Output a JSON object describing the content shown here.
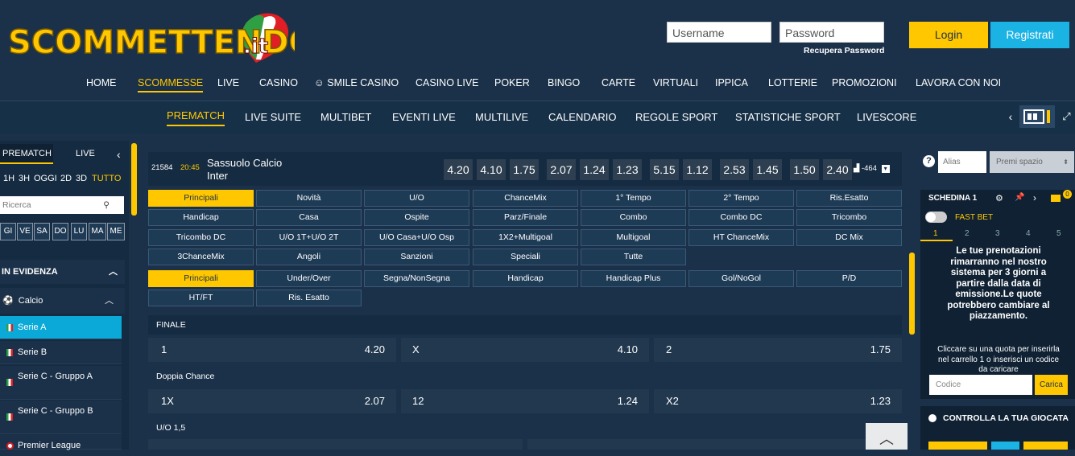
{
  "header": {
    "logo_text": "SCOMMETTENDO",
    "logo_suffix": ".it",
    "username_placeholder": "Username",
    "password_placeholder": "Password",
    "recover_password": "Recupera Password",
    "login": "Login",
    "register": "Registrati",
    "colors": {
      "accent": "#ffc700",
      "register": "#1bb2e4",
      "bg": "#1b3149"
    }
  },
  "main_nav": [
    "HOME",
    "SCOMMESSE",
    "LIVE",
    "CASINO",
    "SMILE CASINO",
    "CASINO LIVE",
    "POKER",
    "BINGO",
    "CARTE",
    "VIRTUALI",
    "IPPICA",
    "LOTTERIE",
    "PROMOZIONI",
    "LAVORA CON NOI"
  ],
  "sub_nav": [
    "PREMATCH",
    "LIVE SUITE",
    "MULTIBET",
    "EVENTI LIVE",
    "MULTILIVE",
    "CALENDARIO",
    "REGOLE SPORT",
    "STATISTICHE SPORT",
    "LIVESCORE"
  ],
  "left": {
    "tab_prematch": "PREMATCH",
    "tab_live": "LIVE",
    "filters": [
      "1H",
      "3H",
      "OGGI",
      "2D",
      "3D",
      "TUTTO"
    ],
    "search_placeholder": "Ricerca",
    "days": [
      "GI",
      "VE",
      "SA",
      "DO",
      "LU",
      "MA",
      "ME"
    ],
    "in_evidenza": "IN EVIDENZA",
    "sport": "Calcio",
    "leagues": [
      "Serie A",
      "Serie B",
      "Serie C - Gruppo A",
      "Serie C - Gruppo B",
      "Premier League"
    ]
  },
  "event": {
    "code": "21584",
    "time": "20:45",
    "home": "Sassuolo Calcio",
    "away": "Inter",
    "odds": [
      "4.20",
      "4.10",
      "1.75",
      "2.07",
      "1.24",
      "1.23",
      "5.15",
      "1.12",
      "2.53",
      "1.45",
      "1.50",
      "2.40"
    ],
    "more": "-464"
  },
  "tabs1": [
    "Principali",
    "Novità",
    "U/O",
    "ChanceMix",
    "1° Tempo",
    "2° Tempo",
    "Ris.Esatto",
    "Handicap",
    "Casa",
    "Ospite",
    "Parz/Finale",
    "Combo",
    "Combo DC",
    "Tricombo",
    "Tricombo DC",
    "U/O 1T+U/O 2T",
    "U/O Casa+U/O Osp",
    "1X2+Multigoal",
    "Multigoal",
    "HT ChanceMix",
    "DC Mix",
    "3ChanceMix",
    "Angoli",
    "Sanzioni",
    "Speciali",
    "Tutte"
  ],
  "tabs2": [
    "Principali",
    "Under/Over",
    "Segna/NonSegna",
    "Handicap",
    "Handicap Plus",
    "Gol/NoGol",
    "P/D",
    "HT/FT",
    "Ris. Esatto"
  ],
  "markets": [
    {
      "title": "FINALE",
      "outcomes": [
        {
          "label": "1",
          "odd": "4.20"
        },
        {
          "label": "X",
          "odd": "4.10"
        },
        {
          "label": "2",
          "odd": "1.75"
        }
      ]
    },
    {
      "title": "Doppia Chance",
      "outcomes": [
        {
          "label": "1X",
          "odd": "2.07"
        },
        {
          "label": "12",
          "odd": "1.24"
        },
        {
          "label": "X2",
          "odd": "1.23"
        }
      ]
    },
    {
      "title": "U/O 1,5",
      "outcomes": []
    }
  ],
  "right": {
    "alias_placeholder": "Alias",
    "premi_spazio": "Premi spazio",
    "schedina": "SCHEDINA 1",
    "cart_count": "0",
    "fast_bet": "FAST BET",
    "steps": [
      "1",
      "2",
      "3",
      "4",
      "5"
    ],
    "notice": "Le tue prenotazioni rimarranno nel nostro sistema per 3 giorni a partire dalla data di emissione.Le quote potrebbero cambiare al piazzamento.",
    "click_text": "Cliccare su una quota per inserirla nel carrello 1 o inserisci un codice da caricare",
    "code_placeholder": "Codice",
    "load": "Carica",
    "controlla": "CONTROLLA LA TUA GIOCATA"
  }
}
